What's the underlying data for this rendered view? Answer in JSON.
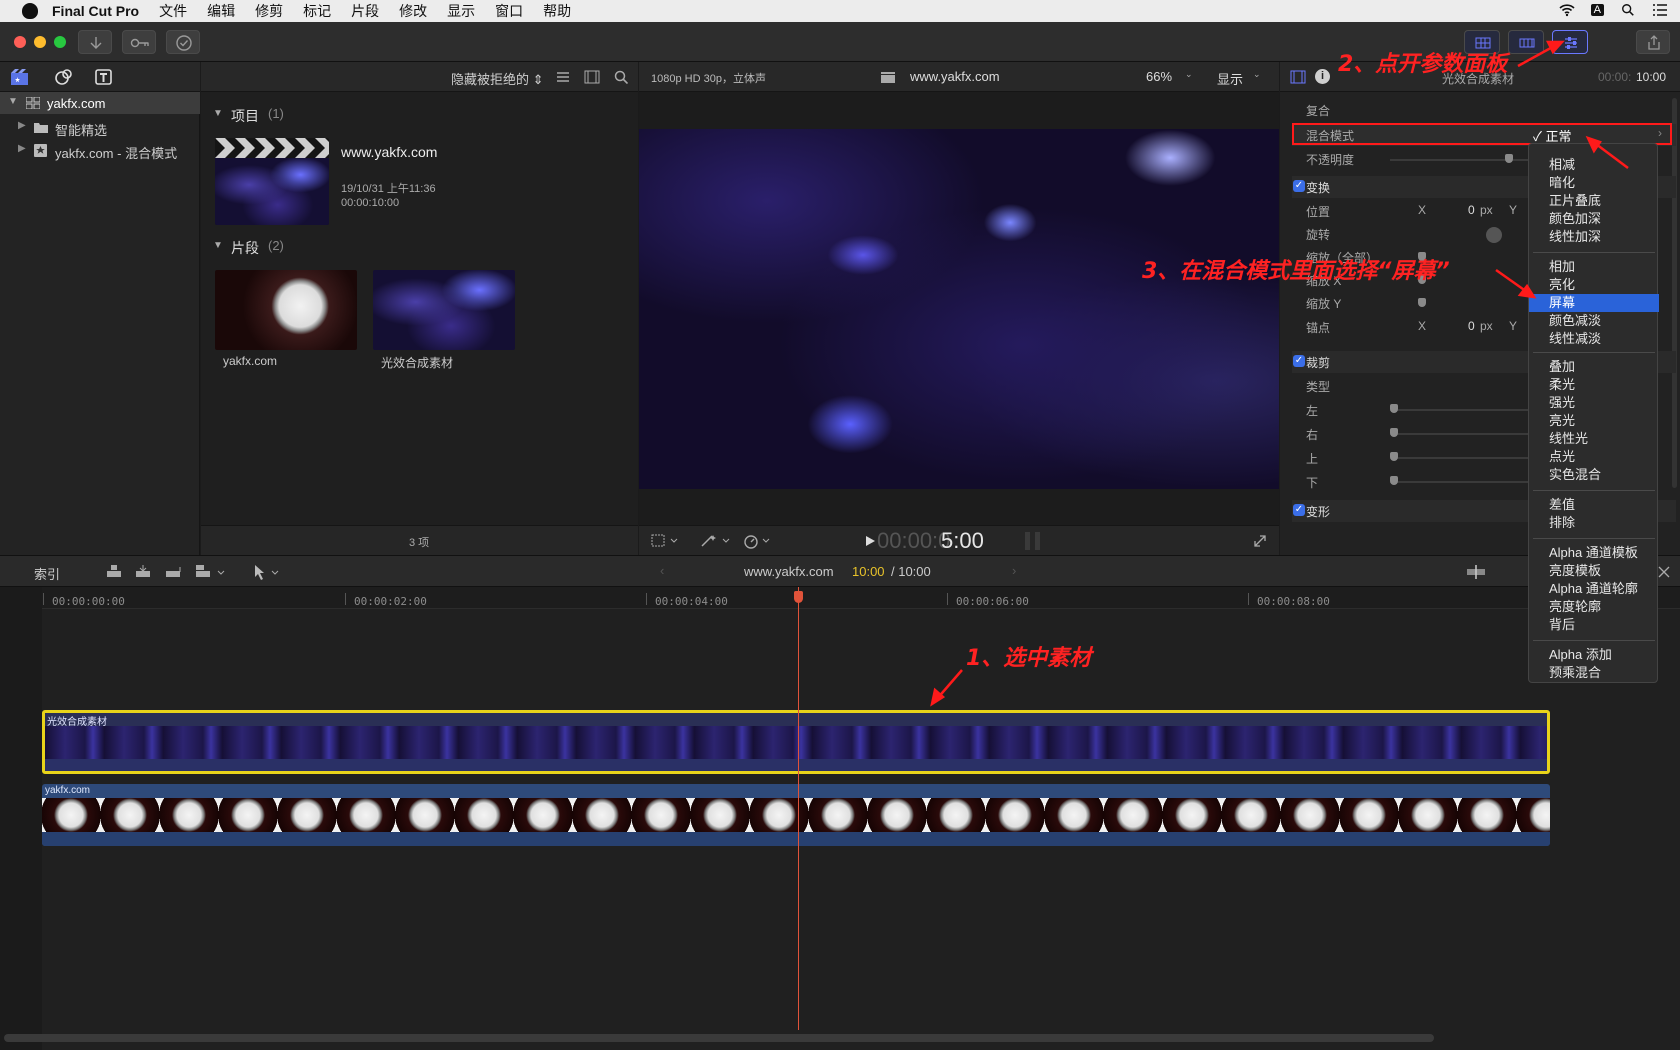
{
  "menubar": {
    "app_name": "Final Cut Pro",
    "items": [
      "文件",
      "编辑",
      "修剪",
      "标记",
      "片段",
      "修改",
      "显示",
      "窗口",
      "帮助"
    ],
    "input_indicator": "A"
  },
  "browser": {
    "filter_label": "隐藏被拒绝的 ⇕",
    "library": "yakfx.com",
    "smart_collections": "智能精选",
    "event": "yakfx.com - 混合模式",
    "projects_heading": "项目",
    "projects_count": "(1)",
    "project": {
      "name": "www.yakfx.com",
      "date": "19/10/31 上午11:36",
      "duration": "00:00:10:00"
    },
    "clips_heading": "片段",
    "clips_count": "(2)",
    "clips": [
      {
        "name": "yakfx.com"
      },
      {
        "name": "光效合成素材"
      }
    ],
    "item_count": "3 项"
  },
  "viewer": {
    "format": "1080p HD 30p，立体声",
    "project_title": "www.yakfx.com",
    "zoom": "66%",
    "display": "显示",
    "timecode_dim": "00:00:0",
    "timecode_bright": "5:00"
  },
  "inspector": {
    "clip_name": "光效合成素材",
    "duration_dim": "00:00:",
    "duration_bright": "10:00",
    "sections": {
      "composite": "复合",
      "blend_mode": "混合模式",
      "blend_value": "✓ 正常",
      "opacity": "不透明度",
      "transform": "变换",
      "position": "位置",
      "rotation": "旋转",
      "scale_all": "缩放（全部）",
      "scale_x": "缩放 X",
      "scale_y": "缩放 Y",
      "anchor": "锚点",
      "crop": "裁剪",
      "type": "类型",
      "left": "左",
      "right": "右",
      "top": "上",
      "bottom": "下",
      "distort": "变形"
    },
    "pos_x_label": "X",
    "pos_x_value": "0",
    "px": "px",
    "y_label": "Y",
    "anchor_x_label": "X",
    "anchor_x_value": "0"
  },
  "dropdown": {
    "groups": [
      [
        "相减",
        "暗化",
        "正片叠底",
        "颜色加深",
        "线性加深"
      ],
      [
        "相加",
        "亮化",
        "屏幕",
        "颜色减淡",
        "线性减淡"
      ],
      [
        "叠加",
        "柔光",
        "强光",
        "亮光",
        "线性光",
        "点光",
        "实色混合"
      ],
      [
        "差值",
        "排除"
      ],
      [
        "Alpha 通道模板",
        "亮度模板",
        "Alpha 通道轮廓",
        "亮度轮廓",
        "背后"
      ],
      [
        "Alpha 添加",
        "预乘混合"
      ]
    ],
    "selected": "屏幕"
  },
  "timeline_bar": {
    "index": "索引",
    "project": "www.yakfx.com",
    "time_current": "10:00",
    "time_total": "/ 10:00"
  },
  "ruler": [
    "00:00:00:00",
    "00:00:02:00",
    "00:00:04:00",
    "00:00:06:00",
    "00:00:08:00"
  ],
  "tracks": {
    "upper": "光效合成素材",
    "lower": "yakfx.com"
  },
  "annotations": {
    "step1": "1、选中素材",
    "step2": "2、点开参数面板",
    "step3": "3、在混合模式里面选择“屏幕”"
  },
  "colors": {
    "accent": "#2a63d9",
    "annotation": "#ff2222",
    "selection": "#e8d31a",
    "playhead": "#e0533a"
  }
}
